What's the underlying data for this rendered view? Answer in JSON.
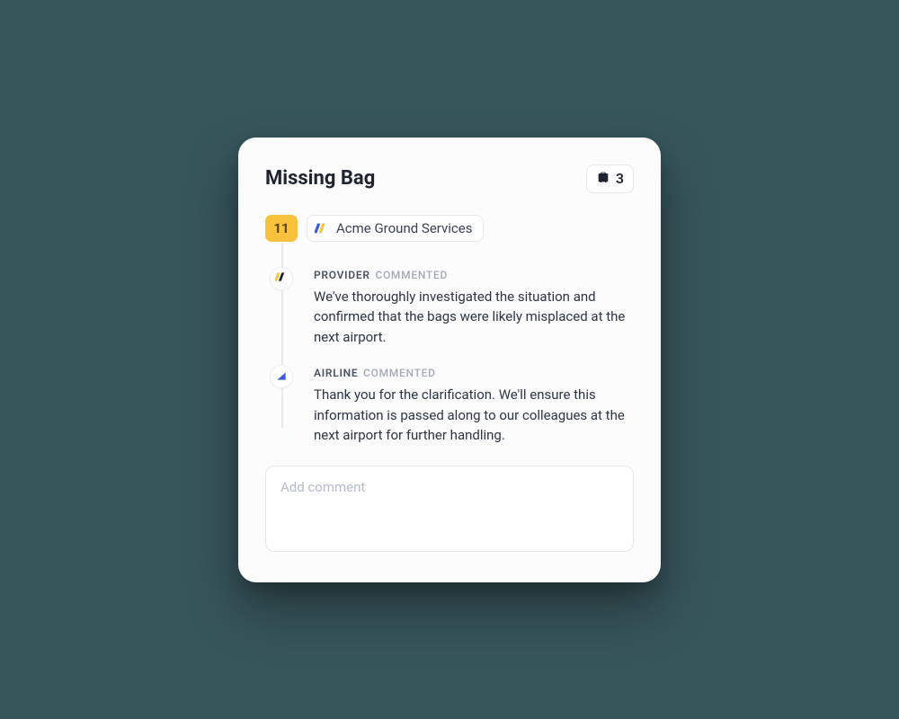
{
  "card": {
    "title": "Missing Bag",
    "bag_count": "3"
  },
  "step": {
    "number": "11",
    "provider_name": "Acme Ground Services"
  },
  "comments": [
    {
      "author_label": "PROVIDER",
      "action_label": "COMMENTED",
      "body": "We've thoroughly investigated the situation and confirmed that the bags were likely misplaced at the next airport."
    },
    {
      "author_label": "AIRLINE",
      "action_label": "COMMENTED",
      "body": "Thank you for the clarification. We'll ensure this information is passed along to our colleagues at the next airport for further handling."
    }
  ],
  "input": {
    "placeholder": "Add comment"
  },
  "icons": {
    "bag": "luggage-icon",
    "provider": "provider-stripes-icon",
    "airline": "airline-tail-icon"
  },
  "colors": {
    "accent_yellow": "#f9c23c",
    "accent_blue": "#3b5bdb",
    "bg": "#37565c",
    "card_bg": "#fcfcfd"
  }
}
